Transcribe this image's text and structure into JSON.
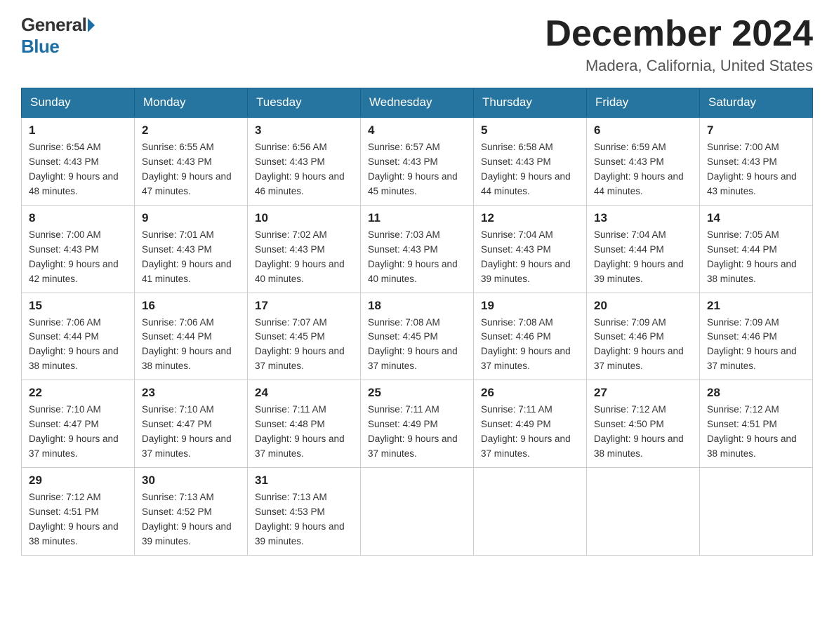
{
  "logo": {
    "general": "General",
    "blue": "Blue"
  },
  "title": "December 2024",
  "location": "Madera, California, United States",
  "headers": [
    "Sunday",
    "Monday",
    "Tuesday",
    "Wednesday",
    "Thursday",
    "Friday",
    "Saturday"
  ],
  "weeks": [
    [
      {
        "day": "1",
        "sunrise": "Sunrise: 6:54 AM",
        "sunset": "Sunset: 4:43 PM",
        "daylight": "Daylight: 9 hours and 48 minutes."
      },
      {
        "day": "2",
        "sunrise": "Sunrise: 6:55 AM",
        "sunset": "Sunset: 4:43 PM",
        "daylight": "Daylight: 9 hours and 47 minutes."
      },
      {
        "day": "3",
        "sunrise": "Sunrise: 6:56 AM",
        "sunset": "Sunset: 4:43 PM",
        "daylight": "Daylight: 9 hours and 46 minutes."
      },
      {
        "day": "4",
        "sunrise": "Sunrise: 6:57 AM",
        "sunset": "Sunset: 4:43 PM",
        "daylight": "Daylight: 9 hours and 45 minutes."
      },
      {
        "day": "5",
        "sunrise": "Sunrise: 6:58 AM",
        "sunset": "Sunset: 4:43 PM",
        "daylight": "Daylight: 9 hours and 44 minutes."
      },
      {
        "day": "6",
        "sunrise": "Sunrise: 6:59 AM",
        "sunset": "Sunset: 4:43 PM",
        "daylight": "Daylight: 9 hours and 44 minutes."
      },
      {
        "day": "7",
        "sunrise": "Sunrise: 7:00 AM",
        "sunset": "Sunset: 4:43 PM",
        "daylight": "Daylight: 9 hours and 43 minutes."
      }
    ],
    [
      {
        "day": "8",
        "sunrise": "Sunrise: 7:00 AM",
        "sunset": "Sunset: 4:43 PM",
        "daylight": "Daylight: 9 hours and 42 minutes."
      },
      {
        "day": "9",
        "sunrise": "Sunrise: 7:01 AM",
        "sunset": "Sunset: 4:43 PM",
        "daylight": "Daylight: 9 hours and 41 minutes."
      },
      {
        "day": "10",
        "sunrise": "Sunrise: 7:02 AM",
        "sunset": "Sunset: 4:43 PM",
        "daylight": "Daylight: 9 hours and 40 minutes."
      },
      {
        "day": "11",
        "sunrise": "Sunrise: 7:03 AM",
        "sunset": "Sunset: 4:43 PM",
        "daylight": "Daylight: 9 hours and 40 minutes."
      },
      {
        "day": "12",
        "sunrise": "Sunrise: 7:04 AM",
        "sunset": "Sunset: 4:43 PM",
        "daylight": "Daylight: 9 hours and 39 minutes."
      },
      {
        "day": "13",
        "sunrise": "Sunrise: 7:04 AM",
        "sunset": "Sunset: 4:44 PM",
        "daylight": "Daylight: 9 hours and 39 minutes."
      },
      {
        "day": "14",
        "sunrise": "Sunrise: 7:05 AM",
        "sunset": "Sunset: 4:44 PM",
        "daylight": "Daylight: 9 hours and 38 minutes."
      }
    ],
    [
      {
        "day": "15",
        "sunrise": "Sunrise: 7:06 AM",
        "sunset": "Sunset: 4:44 PM",
        "daylight": "Daylight: 9 hours and 38 minutes."
      },
      {
        "day": "16",
        "sunrise": "Sunrise: 7:06 AM",
        "sunset": "Sunset: 4:44 PM",
        "daylight": "Daylight: 9 hours and 38 minutes."
      },
      {
        "day": "17",
        "sunrise": "Sunrise: 7:07 AM",
        "sunset": "Sunset: 4:45 PM",
        "daylight": "Daylight: 9 hours and 37 minutes."
      },
      {
        "day": "18",
        "sunrise": "Sunrise: 7:08 AM",
        "sunset": "Sunset: 4:45 PM",
        "daylight": "Daylight: 9 hours and 37 minutes."
      },
      {
        "day": "19",
        "sunrise": "Sunrise: 7:08 AM",
        "sunset": "Sunset: 4:46 PM",
        "daylight": "Daylight: 9 hours and 37 minutes."
      },
      {
        "day": "20",
        "sunrise": "Sunrise: 7:09 AM",
        "sunset": "Sunset: 4:46 PM",
        "daylight": "Daylight: 9 hours and 37 minutes."
      },
      {
        "day": "21",
        "sunrise": "Sunrise: 7:09 AM",
        "sunset": "Sunset: 4:46 PM",
        "daylight": "Daylight: 9 hours and 37 minutes."
      }
    ],
    [
      {
        "day": "22",
        "sunrise": "Sunrise: 7:10 AM",
        "sunset": "Sunset: 4:47 PM",
        "daylight": "Daylight: 9 hours and 37 minutes."
      },
      {
        "day": "23",
        "sunrise": "Sunrise: 7:10 AM",
        "sunset": "Sunset: 4:47 PM",
        "daylight": "Daylight: 9 hours and 37 minutes."
      },
      {
        "day": "24",
        "sunrise": "Sunrise: 7:11 AM",
        "sunset": "Sunset: 4:48 PM",
        "daylight": "Daylight: 9 hours and 37 minutes."
      },
      {
        "day": "25",
        "sunrise": "Sunrise: 7:11 AM",
        "sunset": "Sunset: 4:49 PM",
        "daylight": "Daylight: 9 hours and 37 minutes."
      },
      {
        "day": "26",
        "sunrise": "Sunrise: 7:11 AM",
        "sunset": "Sunset: 4:49 PM",
        "daylight": "Daylight: 9 hours and 37 minutes."
      },
      {
        "day": "27",
        "sunrise": "Sunrise: 7:12 AM",
        "sunset": "Sunset: 4:50 PM",
        "daylight": "Daylight: 9 hours and 38 minutes."
      },
      {
        "day": "28",
        "sunrise": "Sunrise: 7:12 AM",
        "sunset": "Sunset: 4:51 PM",
        "daylight": "Daylight: 9 hours and 38 minutes."
      }
    ],
    [
      {
        "day": "29",
        "sunrise": "Sunrise: 7:12 AM",
        "sunset": "Sunset: 4:51 PM",
        "daylight": "Daylight: 9 hours and 38 minutes."
      },
      {
        "day": "30",
        "sunrise": "Sunrise: 7:13 AM",
        "sunset": "Sunset: 4:52 PM",
        "daylight": "Daylight: 9 hours and 39 minutes."
      },
      {
        "day": "31",
        "sunrise": "Sunrise: 7:13 AM",
        "sunset": "Sunset: 4:53 PM",
        "daylight": "Daylight: 9 hours and 39 minutes."
      },
      null,
      null,
      null,
      null
    ]
  ]
}
